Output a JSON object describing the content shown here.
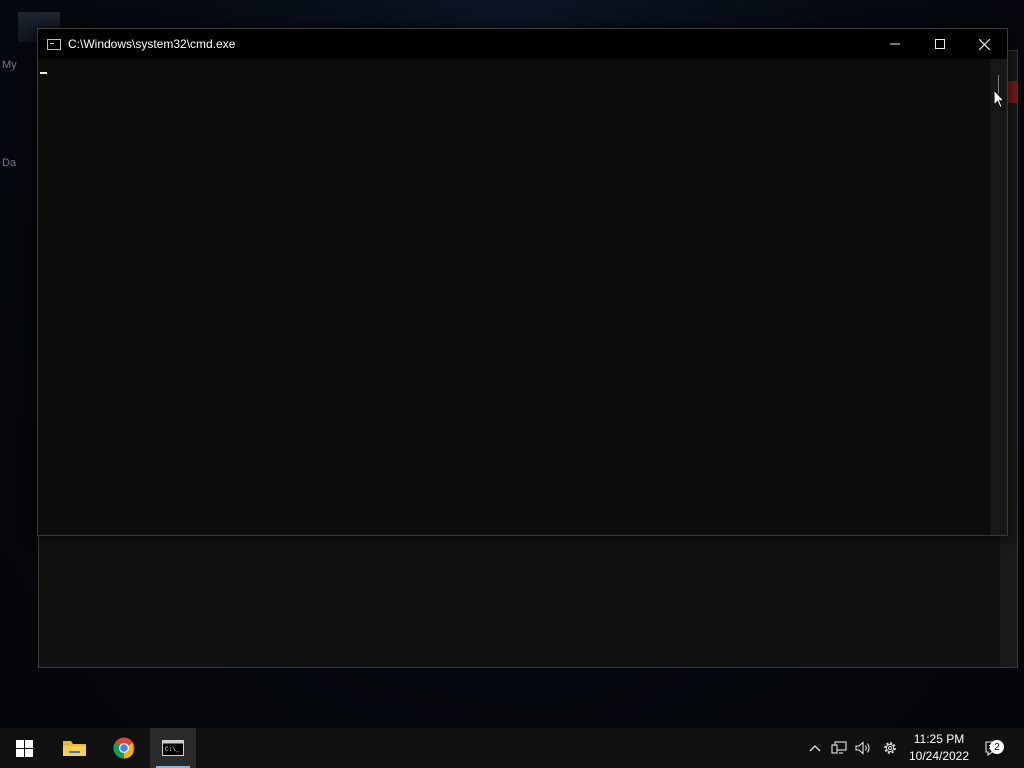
{
  "desktop": {
    "label_1": "My",
    "label_2": "Da"
  },
  "window": {
    "title": "C:\\Windows\\system32\\cmd.exe",
    "icon": "cmd-icon",
    "minimize_icon": "minimize-icon",
    "maximize_icon": "maximize-icon",
    "close_icon": "close-icon",
    "console_text": ""
  },
  "taskbar": {
    "start_icon": "windows-logo-icon",
    "pinned": [
      {
        "name": "File Explorer",
        "icon": "folder-icon"
      },
      {
        "name": "Google Chrome",
        "icon": "chrome-icon"
      },
      {
        "name": "Command Prompt",
        "icon": "cmd-icon",
        "active": true
      }
    ],
    "tray": {
      "chevron_icon": "chevron-up-icon",
      "network_icon": "network-icon",
      "volume_icon": "volume-icon",
      "settings_icon": "gear-icon"
    },
    "clock": {
      "time": "11:25 PM",
      "date": "10/24/2022"
    },
    "notifications_count": "2"
  },
  "colors": {
    "console_bg": "#0c0c0c",
    "titlebar_bg": "#000000",
    "taskbar_bg": "#101010",
    "active_accent": "#76b9ed"
  }
}
